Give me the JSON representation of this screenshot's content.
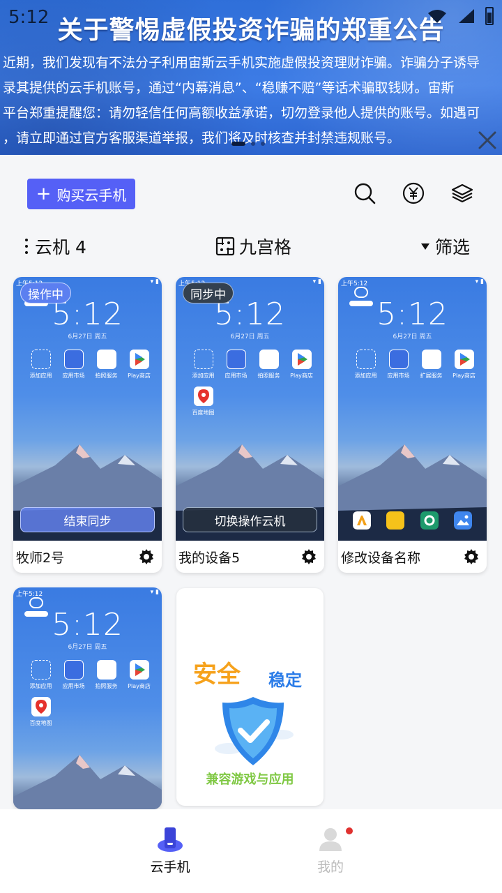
{
  "status_bar": {
    "time": "5:12"
  },
  "banner": {
    "title": "关于警惕虚假投资诈骗的郑重公告",
    "lines": [
      "近期，我们发现有不法分子利用宙斯云手机实施虚假投资理财诈骗。诈骗分子诱导",
      "录其提供的云手机账号，通过“内幕消息”、“稳赚不赔”等话术骗取钱财。宙斯",
      "平台郑重提醒您：请勿轻信任何高额收益承诺，切勿登录他人提供的账号。如遇可",
      "，请立即通过官方客服渠道举报，我们将及时核查并封禁违规账号。"
    ]
  },
  "toolbar": {
    "buy_label": "购买云手机",
    "plus": "+"
  },
  "filter_bar": {
    "count_label": "云机 4",
    "grid_label": "九宫格",
    "filter_label": "筛选"
  },
  "mini_screen": {
    "status_left": "上午5:12",
    "clock": "5:12",
    "date": "6月27日 周五",
    "date_alt": "6月27日 周五"
  },
  "apps": {
    "app1": "添加应用",
    "app2": "应用市场",
    "app3": "拍照服务",
    "app4": "Play商店",
    "app5": "百度地图",
    "app3_alt": "扩展服务",
    "app4_alt": "Play商店"
  },
  "devices": [
    {
      "name": "牧师2号",
      "badge": "操作中",
      "action": "结束同步"
    },
    {
      "name": "我的设备5",
      "badge": "同步中",
      "action": "切换操作云机"
    },
    {
      "name": "修改设备名称",
      "badge": "",
      "action": ""
    },
    {
      "name": "",
      "badge": "",
      "action": ""
    }
  ],
  "promo": {
    "safe": "安全",
    "stable": "稳定",
    "compat": "兼容游戏与应用"
  },
  "bottom_nav": {
    "cloud_phone": "云手机",
    "mine": "我的"
  },
  "colors": {
    "accent": "#5560f6",
    "banner_blue": "#3d7ce6",
    "badge_red": "#e0312f"
  }
}
